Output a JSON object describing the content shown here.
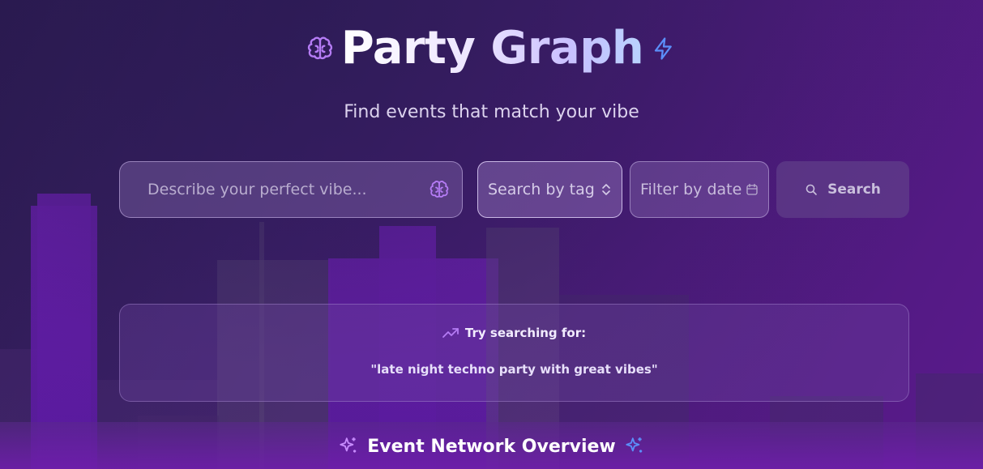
{
  "header": {
    "title": "Party Graph",
    "left_icon": "brain-icon",
    "right_icon": "lightning-icon",
    "subtitle": "Find events that match your vibe"
  },
  "search": {
    "vibe_placeholder": "Describe your perfect vibe...",
    "vibe_icon": "brain-icon",
    "tag_label": "Search by tag",
    "tag_icon": "chevron-updown-icon",
    "date_label": "Filter by date",
    "date_icon": "calendar-icon",
    "button_label": "Search",
    "button_icon": "search-icon"
  },
  "suggestions": {
    "heading": "Try searching for:",
    "heading_icon": "trending-up-icon",
    "example": "\"late night techno party with great vibes\""
  },
  "overview": {
    "title": "Event Network Overview",
    "icons": [
      "sparkles-icon",
      "sparkles-icon"
    ]
  },
  "colors": {
    "accent_purple": "#b57cf5",
    "accent_blue": "#5b8ff9",
    "background_start": "#2b1b4f",
    "background_end": "#5a1a8c"
  }
}
